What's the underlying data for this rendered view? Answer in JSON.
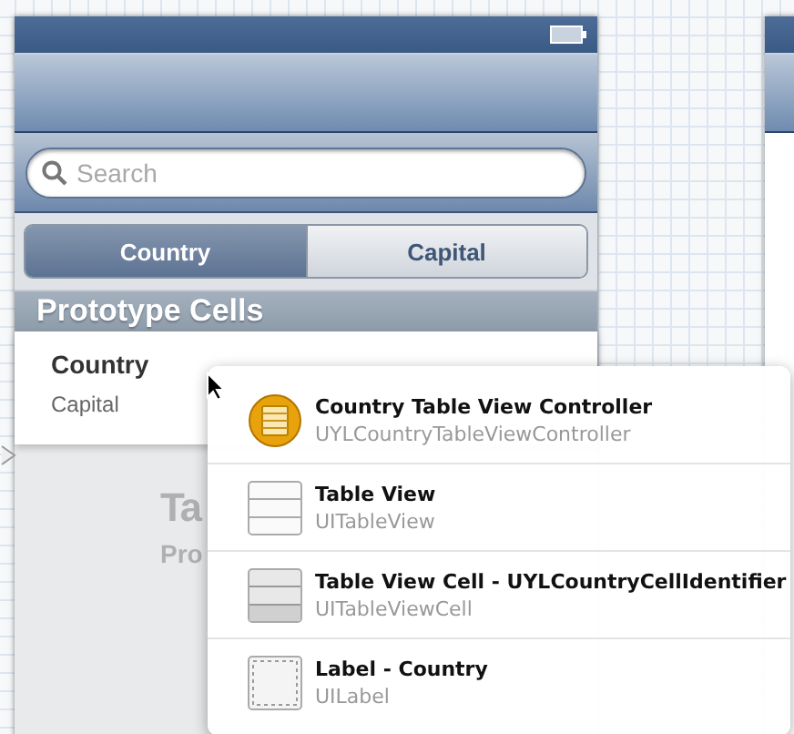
{
  "scene": {
    "search": {
      "placeholder": "Search"
    },
    "segments": [
      {
        "label": "Country",
        "selected": true
      },
      {
        "label": "Capital",
        "selected": false
      }
    ],
    "section_header": "Prototype Cells",
    "cell": {
      "title": "Country",
      "subtitle": "Capital"
    },
    "background_text": [
      "Ta",
      "Pro"
    ]
  },
  "popup": {
    "items": [
      {
        "kind": "controller",
        "title": "Country Table View Controller",
        "class_name": "UYLCountryTableViewController"
      },
      {
        "kind": "table",
        "title": "Table View",
        "class_name": "UITableView"
      },
      {
        "kind": "cell",
        "title": "Table View Cell - UYLCountryCellIdentifier",
        "class_name": "UITableViewCell"
      },
      {
        "kind": "label",
        "title": "Label - Country",
        "class_name": "UILabel"
      }
    ]
  }
}
